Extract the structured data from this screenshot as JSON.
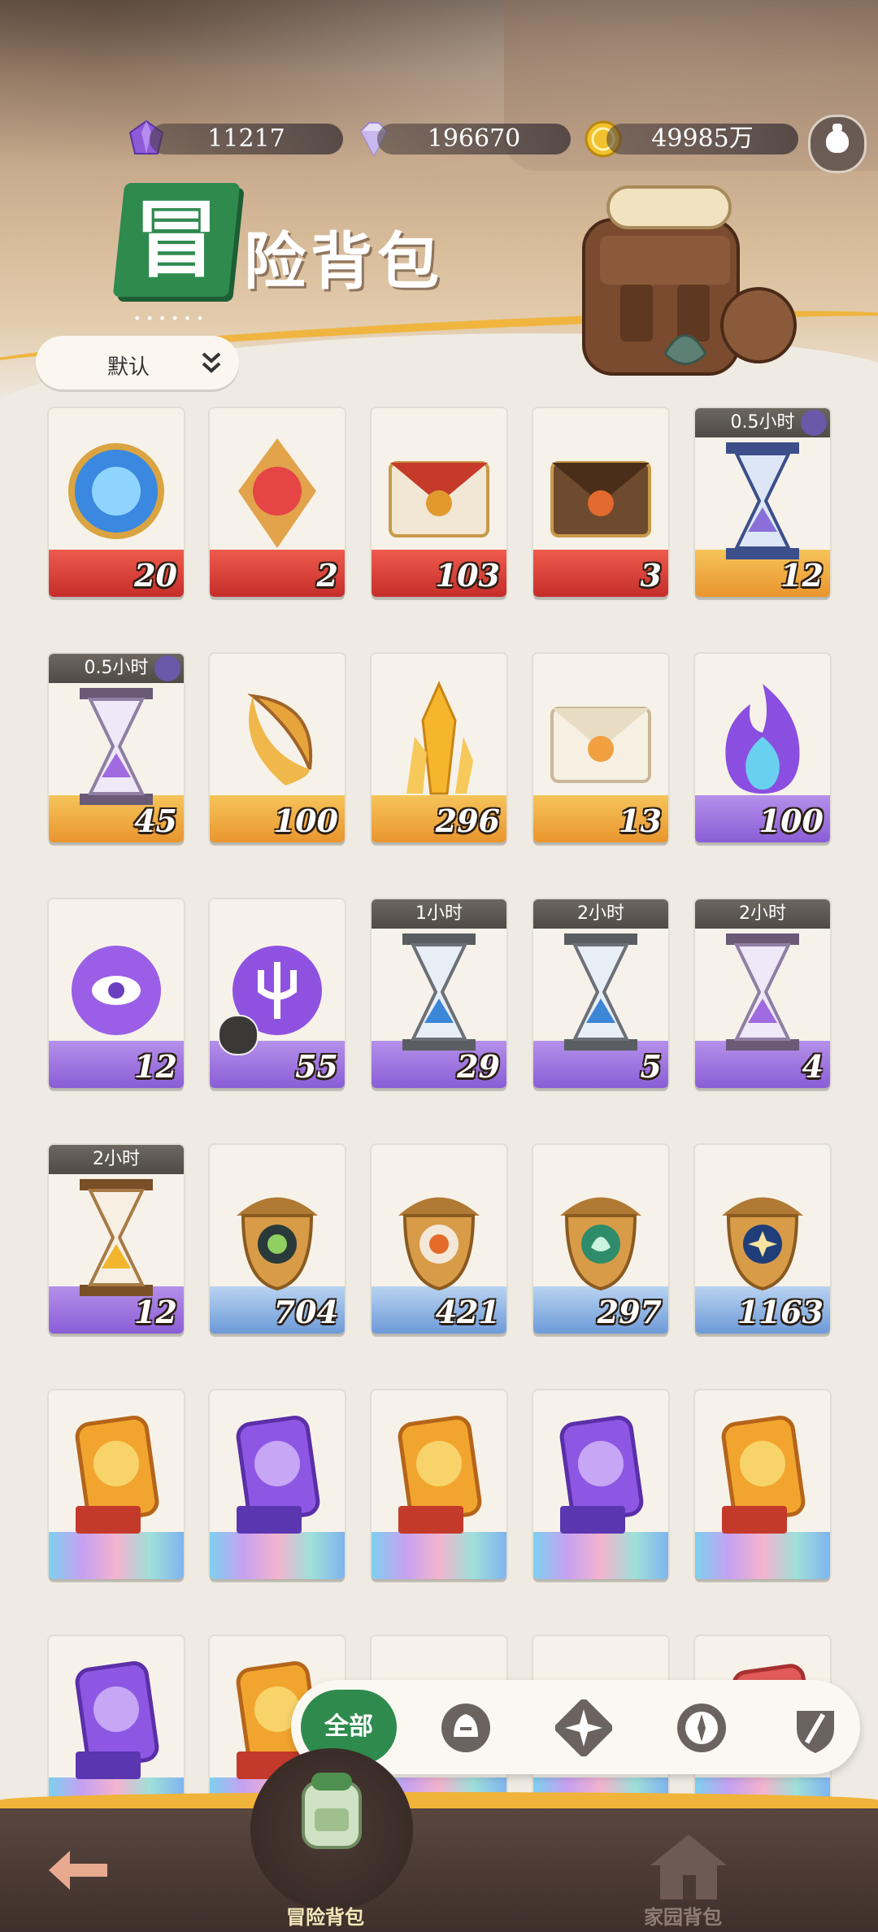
{
  "resources": [
    {
      "icon": "purple-crystal-icon",
      "value": "11217"
    },
    {
      "icon": "diamond-icon",
      "value": "196670"
    },
    {
      "icon": "gold-coin-icon",
      "value": "49985万"
    }
  ],
  "header": {
    "title_badge_char": "冒",
    "title_rest": "险背包",
    "dots": "••••••"
  },
  "sort": {
    "label": "默认",
    "icon": "double-chevron-down-icon"
  },
  "items": [
    {
      "name": "blue-orb-relic",
      "qty": "20",
      "band": "red",
      "art": "orb-blue"
    },
    {
      "name": "red-gem-relic",
      "qty": "2",
      "band": "red",
      "art": "gem-red"
    },
    {
      "name": "red-envelope",
      "qty": "103",
      "band": "red",
      "art": "envelope-red"
    },
    {
      "name": "brown-envelope",
      "qty": "3",
      "band": "red",
      "art": "envelope-brown"
    },
    {
      "name": "blue-hourglass",
      "qty": "12",
      "band": "orange",
      "art": "hourglass-blue",
      "timer": "0.5小时"
    },
    {
      "name": "purple-hourglass",
      "qty": "45",
      "band": "orange",
      "art": "hourglass-purple",
      "timer": "0.5小时"
    },
    {
      "name": "gold-crescent",
      "qty": "100",
      "band": "orange",
      "art": "crescent"
    },
    {
      "name": "gold-crystal",
      "qty": "296",
      "band": "orange",
      "art": "crystal"
    },
    {
      "name": "white-envelope",
      "qty": "13",
      "band": "orange",
      "art": "envelope-white"
    },
    {
      "name": "purple-flame",
      "qty": "100",
      "band": "purple",
      "art": "flame"
    },
    {
      "name": "purple-eye-orb",
      "qty": "12",
      "band": "purple",
      "art": "orb-eye"
    },
    {
      "name": "purple-trident-orb",
      "qty": "55",
      "band": "purple",
      "art": "orb-trident",
      "puzzle": true
    },
    {
      "name": "blue-hourglass-1h",
      "qty": "29",
      "band": "purple",
      "art": "hourglass-blue2",
      "timer": "1小时"
    },
    {
      "name": "blue-hourglass-2h",
      "qty": "5",
      "band": "purple",
      "art": "hourglass-blue2",
      "timer": "2小时"
    },
    {
      "name": "violet-hourglass-2h",
      "qty": "4",
      "band": "purple",
      "art": "hourglass-purple",
      "timer": "2小时"
    },
    {
      "name": "gold-hourglass-2h",
      "qty": "12",
      "band": "purple",
      "art": "hourglass-gold",
      "timer": "2小时"
    },
    {
      "name": "acorn-green-eye",
      "qty": "704",
      "band": "blue",
      "art": "acorn-green"
    },
    {
      "name": "acorn-orange",
      "qty": "421",
      "band": "blue",
      "art": "acorn-orange"
    },
    {
      "name": "acorn-leaf",
      "qty": "297",
      "band": "blue",
      "art": "acorn-leaf"
    },
    {
      "name": "acorn-star",
      "qty": "1163",
      "band": "blue",
      "art": "acorn-star"
    },
    {
      "name": "gold-ticket-1",
      "qty": "",
      "band": "rainbow",
      "art": "ticket-gold"
    },
    {
      "name": "purple-ticket-1",
      "qty": "",
      "band": "rainbow",
      "art": "ticket-purple"
    },
    {
      "name": "gold-ticket-2",
      "qty": "",
      "band": "rainbow",
      "art": "ticket-gold"
    },
    {
      "name": "purple-ticket-2",
      "qty": "",
      "band": "rainbow",
      "art": "ticket-purple"
    },
    {
      "name": "gold-ticket-3",
      "qty": "",
      "band": "rainbow",
      "art": "ticket-gold"
    },
    {
      "name": "purple-ticket-3",
      "qty": "",
      "band": "rainbow",
      "art": "ticket-purple"
    },
    {
      "name": "gold-ticket-4",
      "qty": "",
      "band": "rainbow",
      "art": "ticket-gold"
    },
    {
      "name": "item-partial-3",
      "qty": "",
      "band": "rainbow",
      "art": "blank"
    },
    {
      "name": "item-partial-4",
      "qty": "",
      "band": "rainbow",
      "art": "blank"
    },
    {
      "name": "item-partial-5",
      "qty": "",
      "band": "rainbow",
      "art": "ticket-red"
    }
  ],
  "filters": {
    "all_label": "全部",
    "icons": [
      "helmet-icon",
      "compass-star-icon",
      "compass-icon",
      "sword-shield-icon"
    ]
  },
  "bottom_nav": {
    "back_icon": "back-arrow-icon",
    "adventure_label": "冒险背包",
    "home_label": "家园背包"
  },
  "colors": {
    "accent_green": "#2f8a4e",
    "gold": "#f0b43a",
    "nav_brown": "#4a3a34"
  }
}
